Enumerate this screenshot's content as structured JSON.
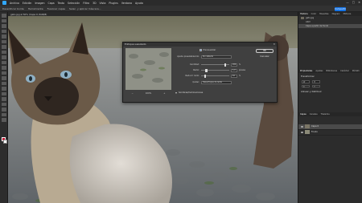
{
  "menubar": {
    "items": [
      "Archivo",
      "Edición",
      "Imagen",
      "Capa",
      "Texto",
      "Selección",
      "Filtro",
      "3D",
      "Vista",
      "Plugins",
      "Ventana",
      "Ayuda"
    ],
    "controls": [
      "—",
      "□",
      "✕"
    ]
  },
  "optionsbar": {
    "items": [
      "Desenfocar borde",
      "Herramienta",
      "Fusionar capas",
      "Selec. y aplicar máscara..."
    ],
    "share_label": "Compartir"
  },
  "document": {
    "tab_label": "gato.jpg al 50% (Capa 0, RGB/8)"
  },
  "right_panel": {
    "history_tabs": [
      "Historia",
      "Color",
      "Muestras",
      "Degrad.",
      "Motivos"
    ],
    "history_items": [
      "gato.jpg",
      "Abrir",
      "Capa a partir de fondo"
    ],
    "properties_tabs": [
      "Propiedades",
      "Ajustes",
      "Bibliotecas",
      "Carácter",
      "Párrafo"
    ],
    "properties_section": "Transformar",
    "fields": [
      "W",
      "H",
      "X",
      "Y"
    ],
    "align_label": "Alinear y distribuir",
    "layers_tabs": [
      "Capas",
      "Canales",
      "Trazados"
    ],
    "layers": [
      "Capa 0",
      "Fondo"
    ]
  },
  "dialog": {
    "title": "Enfoque suavizado",
    "close_icon": "✕",
    "preview_label": "Previsualizar",
    "preset_label": "Ajuste preestablecido:",
    "preset_value": "Por defecto",
    "amount_label": "Cantidad:",
    "amount_value": "200",
    "amount_unit": "%",
    "amount_fraction": 0.82,
    "radius_label": "Radio:",
    "radius_value": "1,0",
    "radius_unit": "píxeles",
    "radius_fraction": 0.15,
    "noise_label": "Reducir ruido:",
    "noise_value": "10",
    "noise_unit": "%",
    "noise_fraction": 0.1,
    "remove_label": "Quitar:",
    "remove_value": "Desenfoque de lente",
    "zoom_value": "100%",
    "zoom_minus": "−",
    "zoom_plus": "+",
    "ok_label": "OK",
    "cancel_label": "Cancelar",
    "advanced_label": "Sombras/Iluminaciones"
  }
}
